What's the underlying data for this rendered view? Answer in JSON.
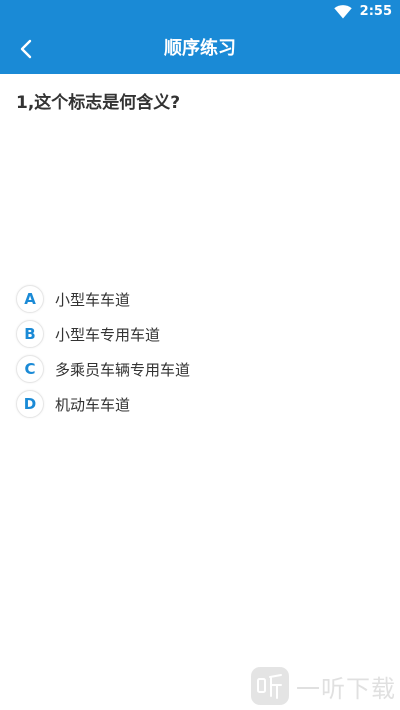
{
  "status_bar": {
    "time": "2:55",
    "icons": [
      "wifi-icon"
    ]
  },
  "header": {
    "title": "顺序练习",
    "back_icon": "chevron-left-icon"
  },
  "question": {
    "text": "1,这个标志是何含义?"
  },
  "options": [
    {
      "letter": "A",
      "text": "小型车车道"
    },
    {
      "letter": "B",
      "text": "小型车专用车道"
    },
    {
      "letter": "C",
      "text": "多乘员车辆专用车道"
    },
    {
      "letter": "D",
      "text": "机动车车道"
    }
  ],
  "watermark": {
    "text": "一听下载"
  },
  "colors": {
    "primary": "#1a8ad6",
    "text": "#333333",
    "background": "#ffffff"
  }
}
